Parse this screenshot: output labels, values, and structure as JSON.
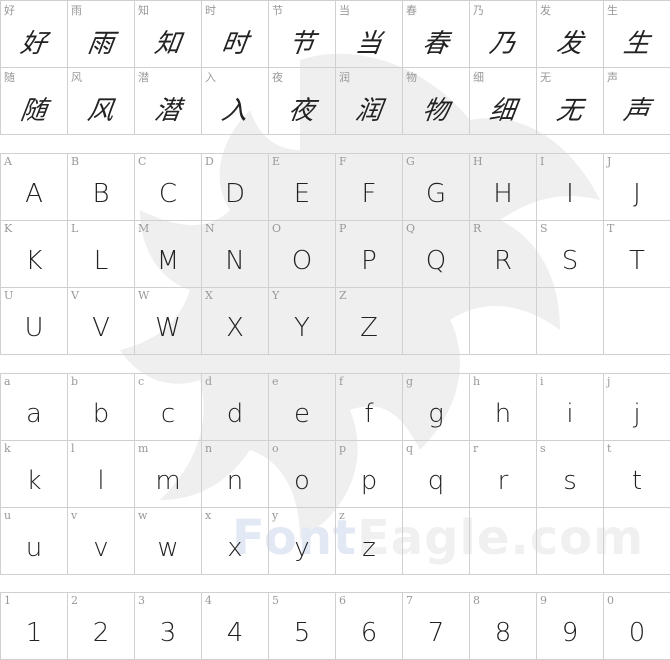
{
  "watermark": {
    "brand_font": "Font",
    "brand_eagle": "Eagle.com",
    "logo": "eagle-silhouette"
  },
  "sections": {
    "cjk": [
      {
        "label": "好",
        "glyph": "好"
      },
      {
        "label": "雨",
        "glyph": "雨"
      },
      {
        "label": "知",
        "glyph": "知"
      },
      {
        "label": "时",
        "glyph": "时"
      },
      {
        "label": "节",
        "glyph": "节"
      },
      {
        "label": "当",
        "glyph": "当"
      },
      {
        "label": "春",
        "glyph": "春"
      },
      {
        "label": "乃",
        "glyph": "乃"
      },
      {
        "label": "发",
        "glyph": "发"
      },
      {
        "label": "生",
        "glyph": "生"
      },
      {
        "label": "随",
        "glyph": "随"
      },
      {
        "label": "风",
        "glyph": "风"
      },
      {
        "label": "潜",
        "glyph": "潜"
      },
      {
        "label": "入",
        "glyph": "入"
      },
      {
        "label": "夜",
        "glyph": "夜"
      },
      {
        "label": "润",
        "glyph": "润"
      },
      {
        "label": "物",
        "glyph": "物"
      },
      {
        "label": "细",
        "glyph": "细"
      },
      {
        "label": "无",
        "glyph": "无"
      },
      {
        "label": "声",
        "glyph": "声"
      }
    ],
    "upper": [
      {
        "label": "A",
        "glyph": "A"
      },
      {
        "label": "B",
        "glyph": "B"
      },
      {
        "label": "C",
        "glyph": "C"
      },
      {
        "label": "D",
        "glyph": "D"
      },
      {
        "label": "E",
        "glyph": "E"
      },
      {
        "label": "F",
        "glyph": "F"
      },
      {
        "label": "G",
        "glyph": "G"
      },
      {
        "label": "H",
        "glyph": "H"
      },
      {
        "label": "I",
        "glyph": "I"
      },
      {
        "label": "J",
        "glyph": "J"
      },
      {
        "label": "K",
        "glyph": "K"
      },
      {
        "label": "L",
        "glyph": "L"
      },
      {
        "label": "M",
        "glyph": "M"
      },
      {
        "label": "N",
        "glyph": "N"
      },
      {
        "label": "O",
        "glyph": "O"
      },
      {
        "label": "P",
        "glyph": "P"
      },
      {
        "label": "Q",
        "glyph": "Q"
      },
      {
        "label": "R",
        "glyph": "R"
      },
      {
        "label": "S",
        "glyph": "S"
      },
      {
        "label": "T",
        "glyph": "T"
      },
      {
        "label": "U",
        "glyph": "U"
      },
      {
        "label": "V",
        "glyph": "V"
      },
      {
        "label": "W",
        "glyph": "W"
      },
      {
        "label": "X",
        "glyph": "X"
      },
      {
        "label": "Y",
        "glyph": "Y"
      },
      {
        "label": "Z",
        "glyph": "Z"
      },
      {
        "label": "",
        "glyph": ""
      },
      {
        "label": "",
        "glyph": ""
      },
      {
        "label": "",
        "glyph": ""
      },
      {
        "label": "",
        "glyph": ""
      }
    ],
    "lower": [
      {
        "label": "a",
        "glyph": "a"
      },
      {
        "label": "b",
        "glyph": "b"
      },
      {
        "label": "c",
        "glyph": "c"
      },
      {
        "label": "d",
        "glyph": "d"
      },
      {
        "label": "e",
        "glyph": "e"
      },
      {
        "label": "f",
        "glyph": "f"
      },
      {
        "label": "g",
        "glyph": "g"
      },
      {
        "label": "h",
        "glyph": "h"
      },
      {
        "label": "i",
        "glyph": "i"
      },
      {
        "label": "j",
        "glyph": "j"
      },
      {
        "label": "k",
        "glyph": "k"
      },
      {
        "label": "l",
        "glyph": "l"
      },
      {
        "label": "m",
        "glyph": "m"
      },
      {
        "label": "n",
        "glyph": "n"
      },
      {
        "label": "o",
        "glyph": "o"
      },
      {
        "label": "p",
        "glyph": "p"
      },
      {
        "label": "q",
        "glyph": "q"
      },
      {
        "label": "r",
        "glyph": "r"
      },
      {
        "label": "s",
        "glyph": "s"
      },
      {
        "label": "t",
        "glyph": "t"
      },
      {
        "label": "u",
        "glyph": "u"
      },
      {
        "label": "v",
        "glyph": "v"
      },
      {
        "label": "w",
        "glyph": "w"
      },
      {
        "label": "x",
        "glyph": "x"
      },
      {
        "label": "y",
        "glyph": "y"
      },
      {
        "label": "z",
        "glyph": "z"
      },
      {
        "label": "",
        "glyph": ""
      },
      {
        "label": "",
        "glyph": ""
      },
      {
        "label": "",
        "glyph": ""
      },
      {
        "label": "",
        "glyph": ""
      }
    ],
    "digits": [
      {
        "label": "1",
        "glyph": "1"
      },
      {
        "label": "2",
        "glyph": "2"
      },
      {
        "label": "3",
        "glyph": "3"
      },
      {
        "label": "4",
        "glyph": "4"
      },
      {
        "label": "5",
        "glyph": "5"
      },
      {
        "label": "6",
        "glyph": "6"
      },
      {
        "label": "7",
        "glyph": "7"
      },
      {
        "label": "8",
        "glyph": "8"
      },
      {
        "label": "9",
        "glyph": "9"
      },
      {
        "label": "0",
        "glyph": "0"
      }
    ]
  }
}
